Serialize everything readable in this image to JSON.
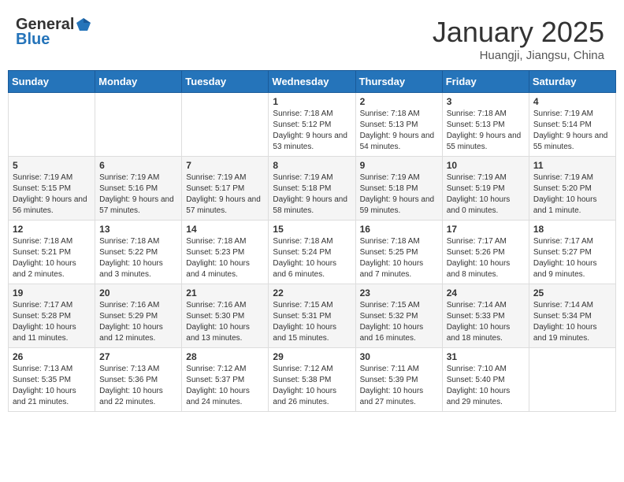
{
  "logo": {
    "general": "General",
    "blue": "Blue"
  },
  "title": {
    "month_year": "January 2025",
    "location": "Huangji, Jiangsu, China"
  },
  "weekdays": [
    "Sunday",
    "Monday",
    "Tuesday",
    "Wednesday",
    "Thursday",
    "Friday",
    "Saturday"
  ],
  "weeks": [
    [
      null,
      null,
      null,
      {
        "day": 1,
        "sunrise": "7:18 AM",
        "sunset": "5:12 PM",
        "daylight": "9 hours and 53 minutes."
      },
      {
        "day": 2,
        "sunrise": "7:18 AM",
        "sunset": "5:13 PM",
        "daylight": "9 hours and 54 minutes."
      },
      {
        "day": 3,
        "sunrise": "7:18 AM",
        "sunset": "5:13 PM",
        "daylight": "9 hours and 55 minutes."
      },
      {
        "day": 4,
        "sunrise": "7:19 AM",
        "sunset": "5:14 PM",
        "daylight": "9 hours and 55 minutes."
      }
    ],
    [
      {
        "day": 5,
        "sunrise": "7:19 AM",
        "sunset": "5:15 PM",
        "daylight": "9 hours and 56 minutes."
      },
      {
        "day": 6,
        "sunrise": "7:19 AM",
        "sunset": "5:16 PM",
        "daylight": "9 hours and 57 minutes."
      },
      {
        "day": 7,
        "sunrise": "7:19 AM",
        "sunset": "5:17 PM",
        "daylight": "9 hours and 57 minutes."
      },
      {
        "day": 8,
        "sunrise": "7:19 AM",
        "sunset": "5:18 PM",
        "daylight": "9 hours and 58 minutes."
      },
      {
        "day": 9,
        "sunrise": "7:19 AM",
        "sunset": "5:18 PM",
        "daylight": "9 hours and 59 minutes."
      },
      {
        "day": 10,
        "sunrise": "7:19 AM",
        "sunset": "5:19 PM",
        "daylight": "10 hours and 0 minutes."
      },
      {
        "day": 11,
        "sunrise": "7:19 AM",
        "sunset": "5:20 PM",
        "daylight": "10 hours and 1 minute."
      }
    ],
    [
      {
        "day": 12,
        "sunrise": "7:18 AM",
        "sunset": "5:21 PM",
        "daylight": "10 hours and 2 minutes."
      },
      {
        "day": 13,
        "sunrise": "7:18 AM",
        "sunset": "5:22 PM",
        "daylight": "10 hours and 3 minutes."
      },
      {
        "day": 14,
        "sunrise": "7:18 AM",
        "sunset": "5:23 PM",
        "daylight": "10 hours and 4 minutes."
      },
      {
        "day": 15,
        "sunrise": "7:18 AM",
        "sunset": "5:24 PM",
        "daylight": "10 hours and 6 minutes."
      },
      {
        "day": 16,
        "sunrise": "7:18 AM",
        "sunset": "5:25 PM",
        "daylight": "10 hours and 7 minutes."
      },
      {
        "day": 17,
        "sunrise": "7:17 AM",
        "sunset": "5:26 PM",
        "daylight": "10 hours and 8 minutes."
      },
      {
        "day": 18,
        "sunrise": "7:17 AM",
        "sunset": "5:27 PM",
        "daylight": "10 hours and 9 minutes."
      }
    ],
    [
      {
        "day": 19,
        "sunrise": "7:17 AM",
        "sunset": "5:28 PM",
        "daylight": "10 hours and 11 minutes."
      },
      {
        "day": 20,
        "sunrise": "7:16 AM",
        "sunset": "5:29 PM",
        "daylight": "10 hours and 12 minutes."
      },
      {
        "day": 21,
        "sunrise": "7:16 AM",
        "sunset": "5:30 PM",
        "daylight": "10 hours and 13 minutes."
      },
      {
        "day": 22,
        "sunrise": "7:15 AM",
        "sunset": "5:31 PM",
        "daylight": "10 hours and 15 minutes."
      },
      {
        "day": 23,
        "sunrise": "7:15 AM",
        "sunset": "5:32 PM",
        "daylight": "10 hours and 16 minutes."
      },
      {
        "day": 24,
        "sunrise": "7:14 AM",
        "sunset": "5:33 PM",
        "daylight": "10 hours and 18 minutes."
      },
      {
        "day": 25,
        "sunrise": "7:14 AM",
        "sunset": "5:34 PM",
        "daylight": "10 hours and 19 minutes."
      }
    ],
    [
      {
        "day": 26,
        "sunrise": "7:13 AM",
        "sunset": "5:35 PM",
        "daylight": "10 hours and 21 minutes."
      },
      {
        "day": 27,
        "sunrise": "7:13 AM",
        "sunset": "5:36 PM",
        "daylight": "10 hours and 22 minutes."
      },
      {
        "day": 28,
        "sunrise": "7:12 AM",
        "sunset": "5:37 PM",
        "daylight": "10 hours and 24 minutes."
      },
      {
        "day": 29,
        "sunrise": "7:12 AM",
        "sunset": "5:38 PM",
        "daylight": "10 hours and 26 minutes."
      },
      {
        "day": 30,
        "sunrise": "7:11 AM",
        "sunset": "5:39 PM",
        "daylight": "10 hours and 27 minutes."
      },
      {
        "day": 31,
        "sunrise": "7:10 AM",
        "sunset": "5:40 PM",
        "daylight": "10 hours and 29 minutes."
      },
      null
    ]
  ]
}
